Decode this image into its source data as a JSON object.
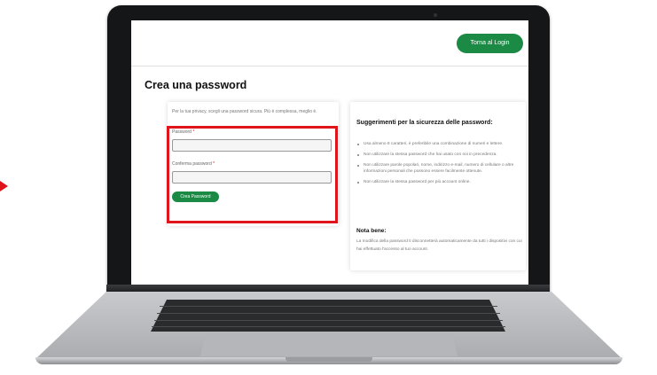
{
  "colors": {
    "brand_green": "#1a8a45",
    "highlight_red": "#e0141b"
  },
  "header": {
    "back_to_login_label": "Torna al Login"
  },
  "page": {
    "title": "Crea una password"
  },
  "form": {
    "intro_text": "Per la tua privacy, scegli una password sicura. Più è complessa, meglio è.",
    "password_label": "Password",
    "password_required_marker": "*",
    "password_value": "",
    "confirm_label": "Conferma password",
    "confirm_required_marker": "*",
    "confirm_value": "",
    "submit_label": "Crea Password"
  },
  "tips": {
    "title": "Suggerimenti per la sicurezza delle password:",
    "items": [
      "Usa almeno 8 caratteri, è preferibile una combinazione di numeri e lettere.",
      "Non utilizzare la stessa password che hai usato con noi in precedenza.",
      "Non utilizzare parole popolari, nome, indirizzo e-mail, numero di cellulare o altre informazioni personali che possono essere facilmente ottenute.",
      "Non utilizzare la stessa password per più account online."
    ],
    "note_title": "Nota bene:",
    "note_text": "La modifica della password ti disconnetterà automaticamente da tutti i dispositivi con cui hai effettuato l'accesso al tuo account."
  }
}
